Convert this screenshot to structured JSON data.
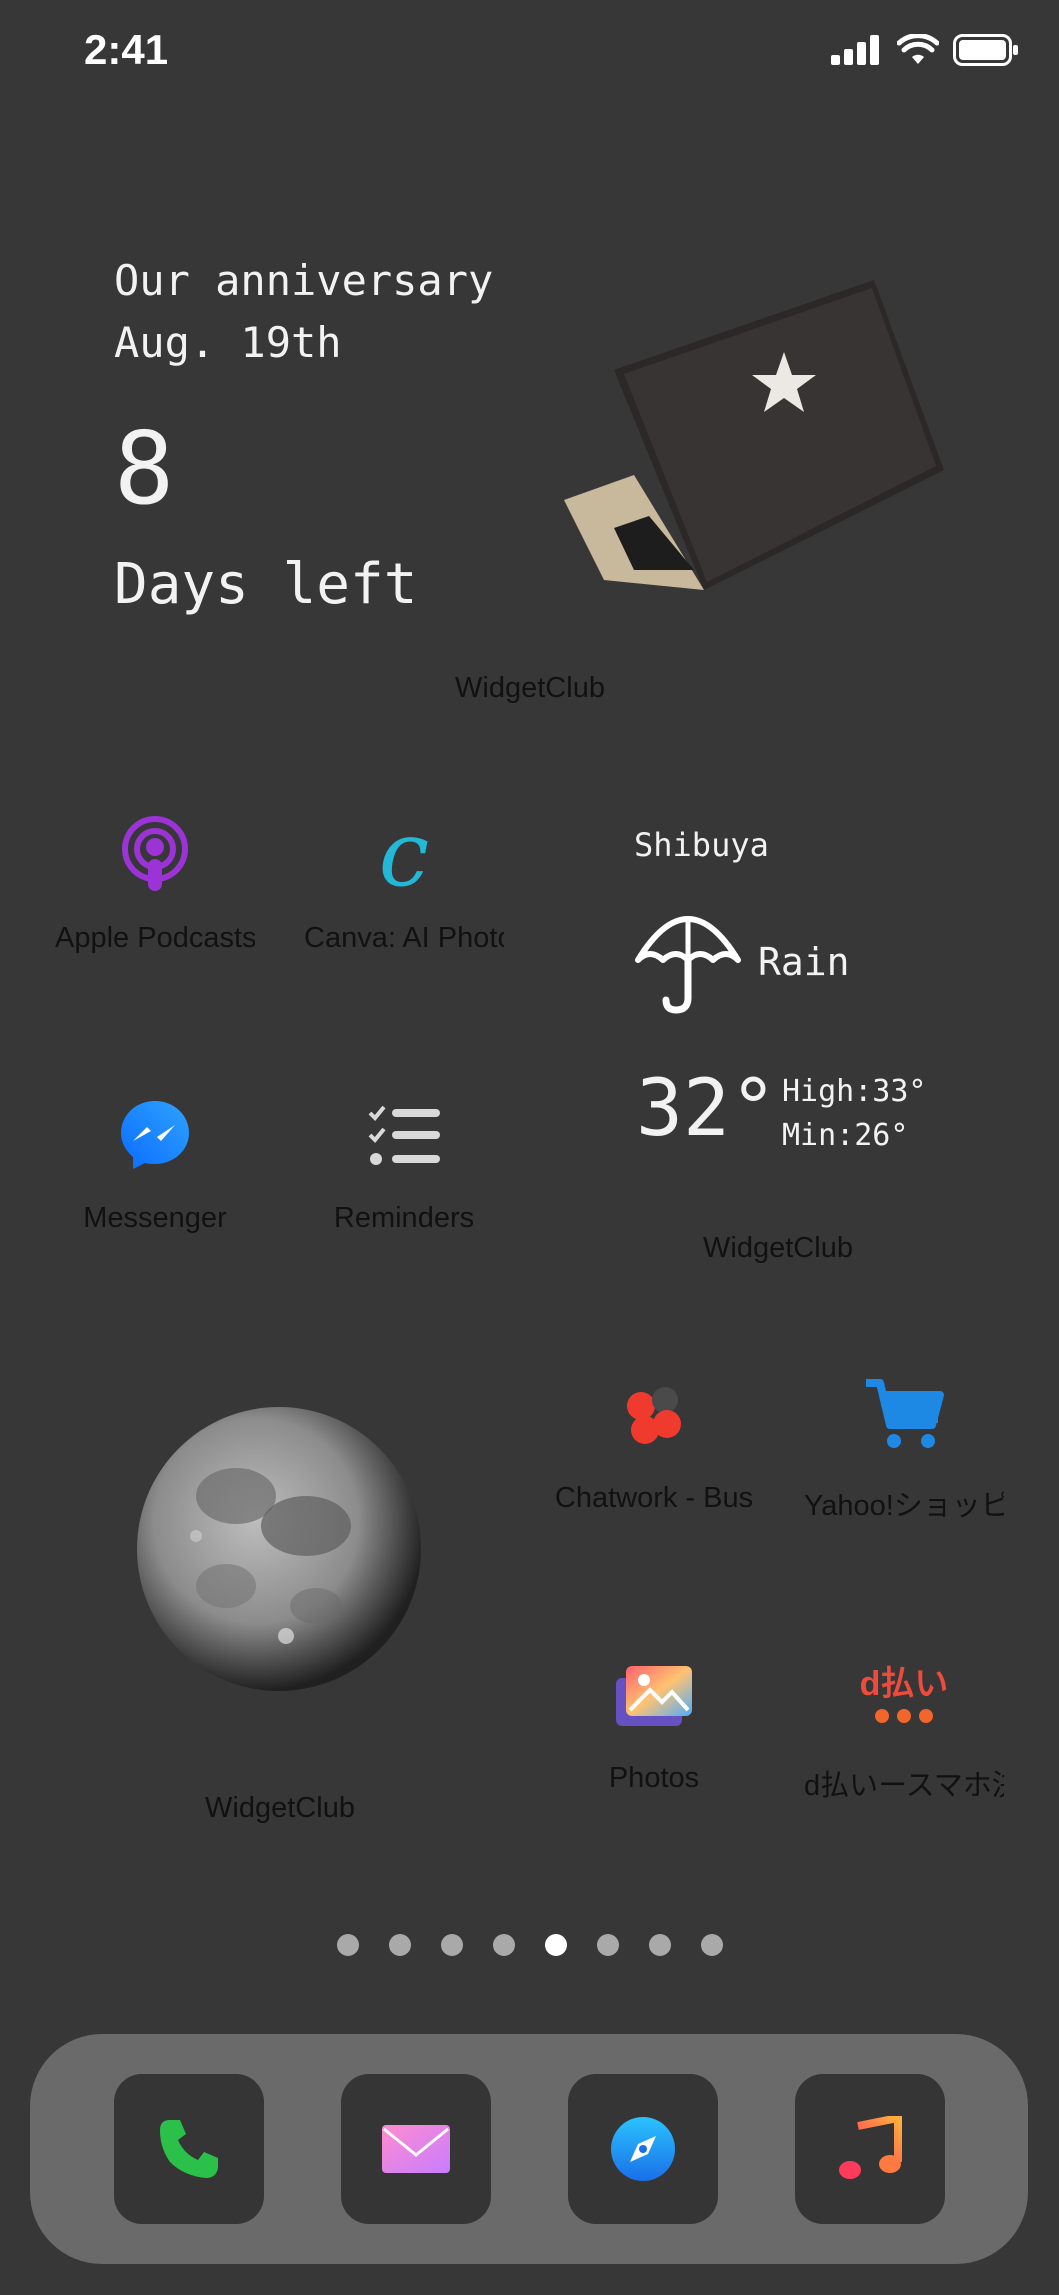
{
  "status_bar": {
    "time": "2:41"
  },
  "anniversary_widget": {
    "line1": "Our anniversary",
    "line2": "Aug. 19th",
    "number": "8",
    "caption": "Days left",
    "label": "WidgetClub"
  },
  "apps_row1": [
    {
      "name": "Apple Podcasts",
      "icon": "podcasts-icon"
    },
    {
      "name": "Canva: AI Photo",
      "icon": "canva-icon"
    }
  ],
  "apps_row2": [
    {
      "name": "Messenger",
      "icon": "messenger-icon"
    },
    {
      "name": "Reminders",
      "icon": "reminders-icon"
    }
  ],
  "weather_widget": {
    "location": "Shibuya",
    "condition": "Rain",
    "temperature": "32°",
    "high": "High:33°",
    "low": "Min:26°",
    "label": "WidgetClub"
  },
  "moon_widget": {
    "label": "WidgetClub"
  },
  "apps_row3": [
    {
      "name": "Chatwork - Bus",
      "icon": "chatwork-icon"
    },
    {
      "name": "Yahoo!ショッピ",
      "icon": "cart-icon"
    }
  ],
  "apps_row4": [
    {
      "name": "Photos",
      "icon": "photos-icon"
    },
    {
      "name": "d払いースマホ決",
      "icon": "dpay-icon"
    }
  ],
  "dpay_logo_text": "d払い",
  "page_dots": {
    "count": 8,
    "active_index": 4
  },
  "dock": [
    {
      "name": "phone",
      "icon": "phone-icon"
    },
    {
      "name": "mail",
      "icon": "mail-icon"
    },
    {
      "name": "safari",
      "icon": "compass-icon"
    },
    {
      "name": "music",
      "icon": "music-icon"
    }
  ],
  "colors": {
    "background": "#373737",
    "dock": "#6a6a6a",
    "podcasts": "#9b33d6",
    "canva": "#22b8d6",
    "messenger": "#1d7bff",
    "cart": "#1e88e5",
    "dpay": "#ef4b3c"
  }
}
